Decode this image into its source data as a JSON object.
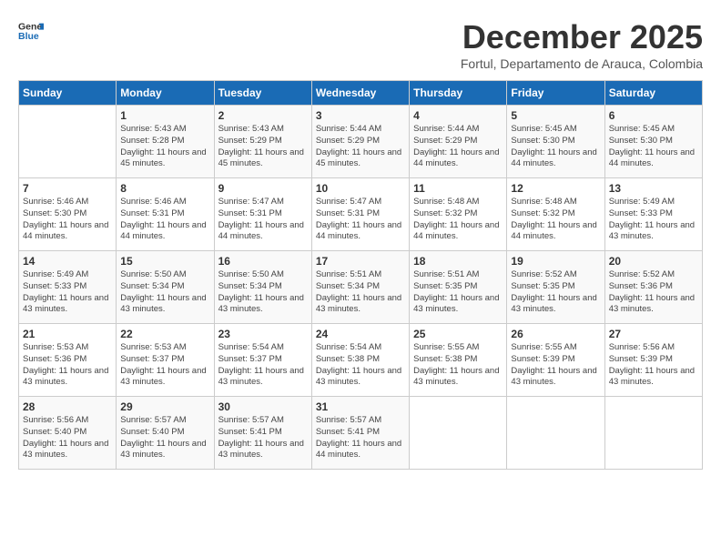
{
  "header": {
    "logo_line1": "General",
    "logo_line2": "Blue",
    "month_title": "December 2025",
    "subtitle": "Fortul, Departamento de Arauca, Colombia"
  },
  "days_of_week": [
    "Sunday",
    "Monday",
    "Tuesday",
    "Wednesday",
    "Thursday",
    "Friday",
    "Saturday"
  ],
  "weeks": [
    [
      {
        "day": "",
        "sunrise": "",
        "sunset": "",
        "daylight": ""
      },
      {
        "day": "1",
        "sunrise": "Sunrise: 5:43 AM",
        "sunset": "Sunset: 5:28 PM",
        "daylight": "Daylight: 11 hours and 45 minutes."
      },
      {
        "day": "2",
        "sunrise": "Sunrise: 5:43 AM",
        "sunset": "Sunset: 5:29 PM",
        "daylight": "Daylight: 11 hours and 45 minutes."
      },
      {
        "day": "3",
        "sunrise": "Sunrise: 5:44 AM",
        "sunset": "Sunset: 5:29 PM",
        "daylight": "Daylight: 11 hours and 45 minutes."
      },
      {
        "day": "4",
        "sunrise": "Sunrise: 5:44 AM",
        "sunset": "Sunset: 5:29 PM",
        "daylight": "Daylight: 11 hours and 44 minutes."
      },
      {
        "day": "5",
        "sunrise": "Sunrise: 5:45 AM",
        "sunset": "Sunset: 5:30 PM",
        "daylight": "Daylight: 11 hours and 44 minutes."
      },
      {
        "day": "6",
        "sunrise": "Sunrise: 5:45 AM",
        "sunset": "Sunset: 5:30 PM",
        "daylight": "Daylight: 11 hours and 44 minutes."
      }
    ],
    [
      {
        "day": "7",
        "sunrise": "Sunrise: 5:46 AM",
        "sunset": "Sunset: 5:30 PM",
        "daylight": "Daylight: 11 hours and 44 minutes."
      },
      {
        "day": "8",
        "sunrise": "Sunrise: 5:46 AM",
        "sunset": "Sunset: 5:31 PM",
        "daylight": "Daylight: 11 hours and 44 minutes."
      },
      {
        "day": "9",
        "sunrise": "Sunrise: 5:47 AM",
        "sunset": "Sunset: 5:31 PM",
        "daylight": "Daylight: 11 hours and 44 minutes."
      },
      {
        "day": "10",
        "sunrise": "Sunrise: 5:47 AM",
        "sunset": "Sunset: 5:31 PM",
        "daylight": "Daylight: 11 hours and 44 minutes."
      },
      {
        "day": "11",
        "sunrise": "Sunrise: 5:48 AM",
        "sunset": "Sunset: 5:32 PM",
        "daylight": "Daylight: 11 hours and 44 minutes."
      },
      {
        "day": "12",
        "sunrise": "Sunrise: 5:48 AM",
        "sunset": "Sunset: 5:32 PM",
        "daylight": "Daylight: 11 hours and 44 minutes."
      },
      {
        "day": "13",
        "sunrise": "Sunrise: 5:49 AM",
        "sunset": "Sunset: 5:33 PM",
        "daylight": "Daylight: 11 hours and 43 minutes."
      }
    ],
    [
      {
        "day": "14",
        "sunrise": "Sunrise: 5:49 AM",
        "sunset": "Sunset: 5:33 PM",
        "daylight": "Daylight: 11 hours and 43 minutes."
      },
      {
        "day": "15",
        "sunrise": "Sunrise: 5:50 AM",
        "sunset": "Sunset: 5:34 PM",
        "daylight": "Daylight: 11 hours and 43 minutes."
      },
      {
        "day": "16",
        "sunrise": "Sunrise: 5:50 AM",
        "sunset": "Sunset: 5:34 PM",
        "daylight": "Daylight: 11 hours and 43 minutes."
      },
      {
        "day": "17",
        "sunrise": "Sunrise: 5:51 AM",
        "sunset": "Sunset: 5:34 PM",
        "daylight": "Daylight: 11 hours and 43 minutes."
      },
      {
        "day": "18",
        "sunrise": "Sunrise: 5:51 AM",
        "sunset": "Sunset: 5:35 PM",
        "daylight": "Daylight: 11 hours and 43 minutes."
      },
      {
        "day": "19",
        "sunrise": "Sunrise: 5:52 AM",
        "sunset": "Sunset: 5:35 PM",
        "daylight": "Daylight: 11 hours and 43 minutes."
      },
      {
        "day": "20",
        "sunrise": "Sunrise: 5:52 AM",
        "sunset": "Sunset: 5:36 PM",
        "daylight": "Daylight: 11 hours and 43 minutes."
      }
    ],
    [
      {
        "day": "21",
        "sunrise": "Sunrise: 5:53 AM",
        "sunset": "Sunset: 5:36 PM",
        "daylight": "Daylight: 11 hours and 43 minutes."
      },
      {
        "day": "22",
        "sunrise": "Sunrise: 5:53 AM",
        "sunset": "Sunset: 5:37 PM",
        "daylight": "Daylight: 11 hours and 43 minutes."
      },
      {
        "day": "23",
        "sunrise": "Sunrise: 5:54 AM",
        "sunset": "Sunset: 5:37 PM",
        "daylight": "Daylight: 11 hours and 43 minutes."
      },
      {
        "day": "24",
        "sunrise": "Sunrise: 5:54 AM",
        "sunset": "Sunset: 5:38 PM",
        "daylight": "Daylight: 11 hours and 43 minutes."
      },
      {
        "day": "25",
        "sunrise": "Sunrise: 5:55 AM",
        "sunset": "Sunset: 5:38 PM",
        "daylight": "Daylight: 11 hours and 43 minutes."
      },
      {
        "day": "26",
        "sunrise": "Sunrise: 5:55 AM",
        "sunset": "Sunset: 5:39 PM",
        "daylight": "Daylight: 11 hours and 43 minutes."
      },
      {
        "day": "27",
        "sunrise": "Sunrise: 5:56 AM",
        "sunset": "Sunset: 5:39 PM",
        "daylight": "Daylight: 11 hours and 43 minutes."
      }
    ],
    [
      {
        "day": "28",
        "sunrise": "Sunrise: 5:56 AM",
        "sunset": "Sunset: 5:40 PM",
        "daylight": "Daylight: 11 hours and 43 minutes."
      },
      {
        "day": "29",
        "sunrise": "Sunrise: 5:57 AM",
        "sunset": "Sunset: 5:40 PM",
        "daylight": "Daylight: 11 hours and 43 minutes."
      },
      {
        "day": "30",
        "sunrise": "Sunrise: 5:57 AM",
        "sunset": "Sunset: 5:41 PM",
        "daylight": "Daylight: 11 hours and 43 minutes."
      },
      {
        "day": "31",
        "sunrise": "Sunrise: 5:57 AM",
        "sunset": "Sunset: 5:41 PM",
        "daylight": "Daylight: 11 hours and 44 minutes."
      },
      {
        "day": "",
        "sunrise": "",
        "sunset": "",
        "daylight": ""
      },
      {
        "day": "",
        "sunrise": "",
        "sunset": "",
        "daylight": ""
      },
      {
        "day": "",
        "sunrise": "",
        "sunset": "",
        "daylight": ""
      }
    ]
  ]
}
